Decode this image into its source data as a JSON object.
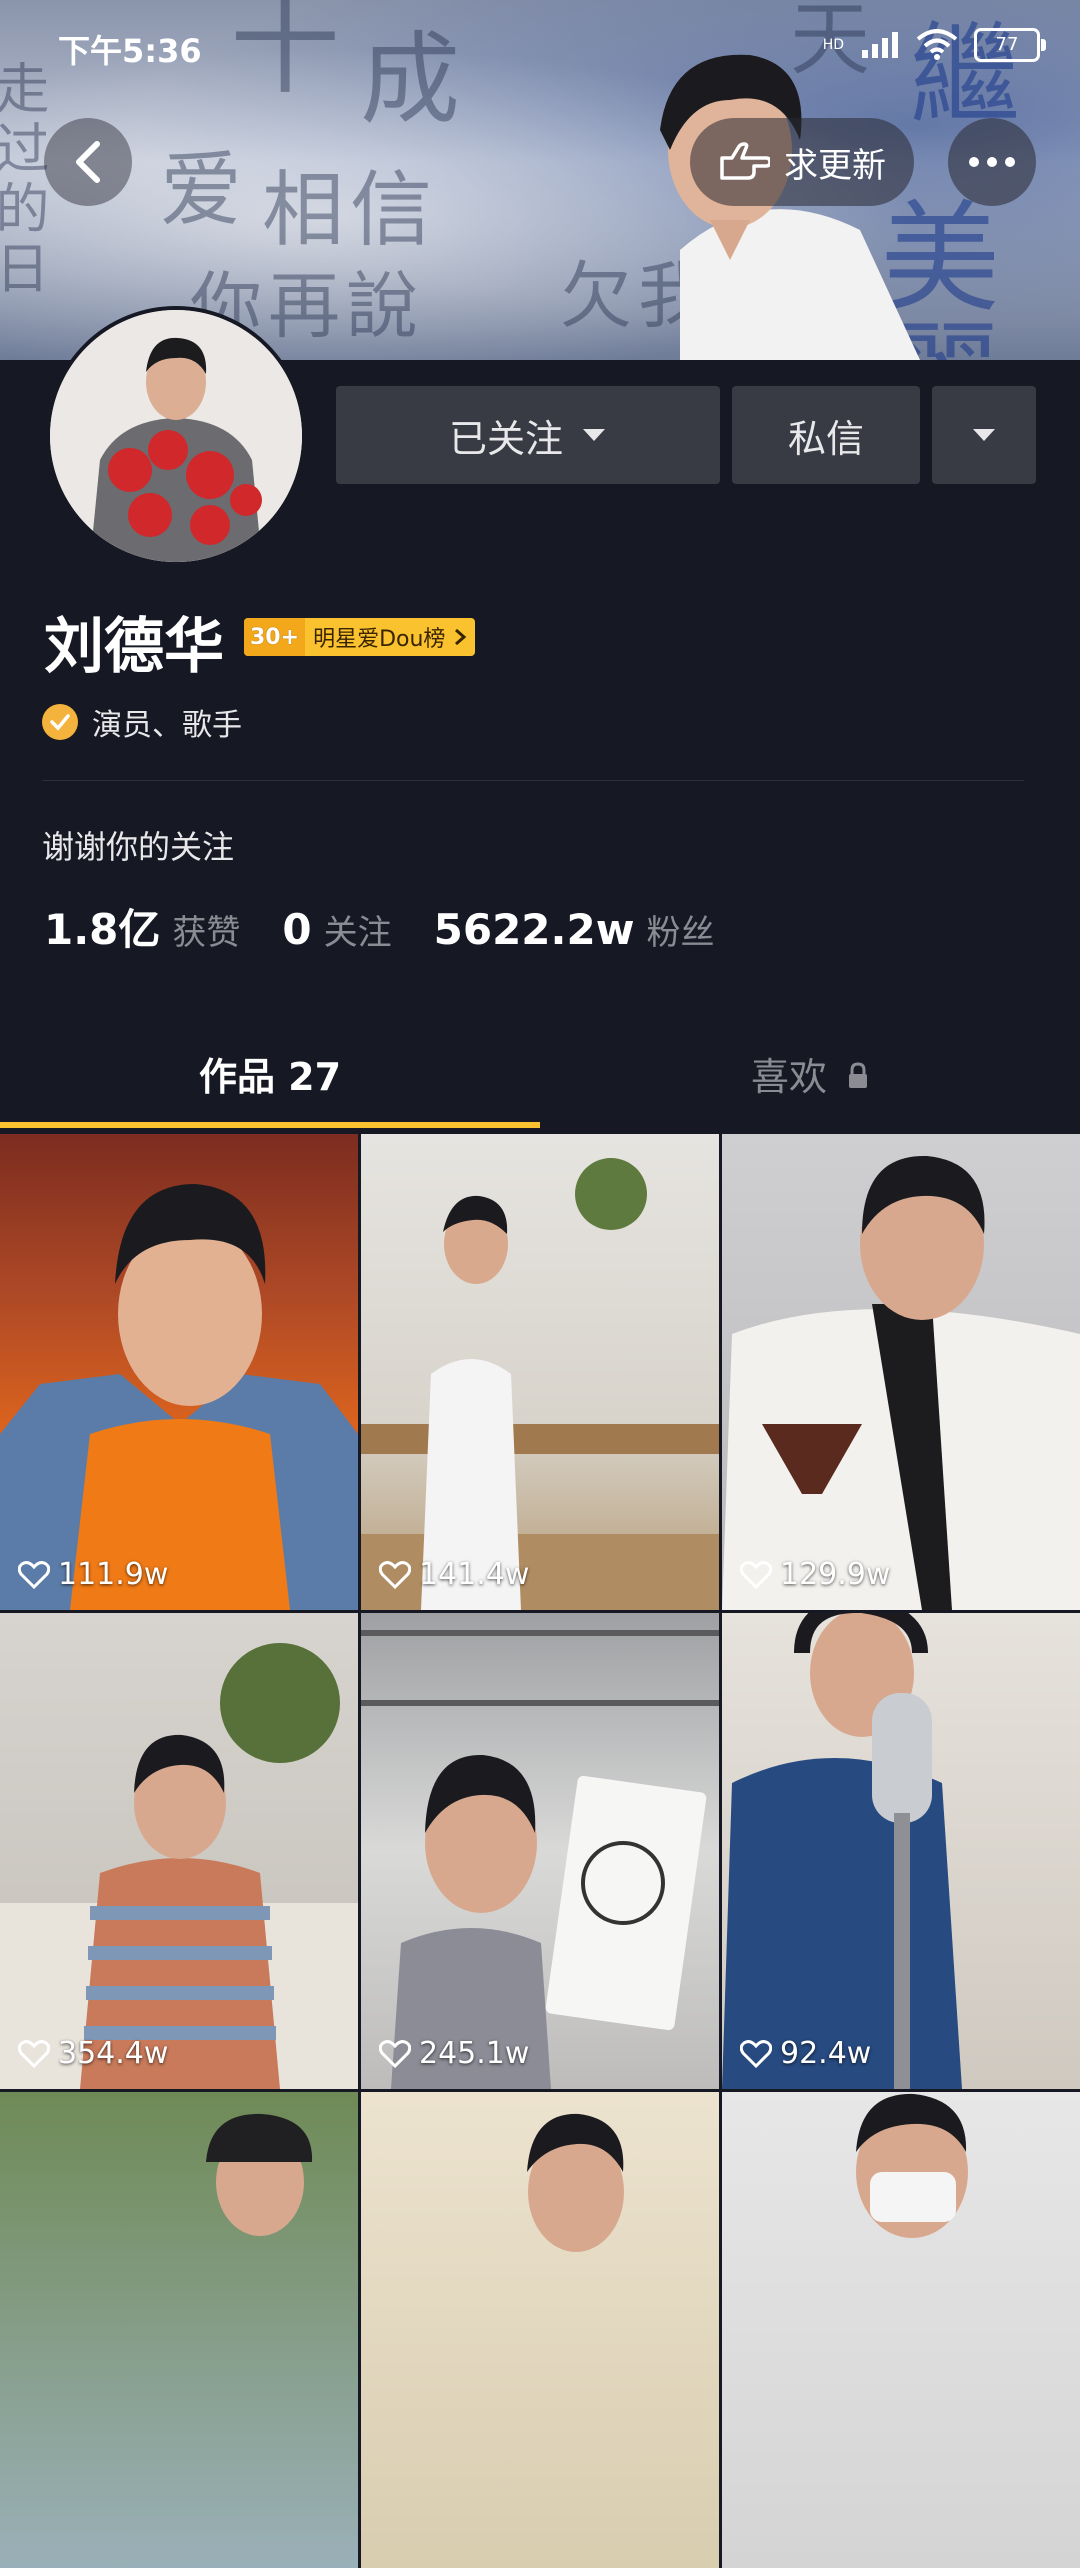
{
  "status_bar": {
    "time": "下午5:36",
    "signal_label": "HD",
    "battery": "77"
  },
  "header": {
    "update_label": "求更新"
  },
  "banner_text": [
    "走过的日",
    "爱",
    "相信",
    "你再說",
    "十",
    "成",
    "欠我",
    "天",
    "繼",
    "美麗"
  ],
  "profile": {
    "follow_label": "已关注",
    "message_label": "私信",
    "name": "刘德华",
    "rank_num": "30+",
    "rank_label": "明星爱Dou榜",
    "verified_label": "演员、歌手",
    "bio": "谢谢你的关注",
    "stats": {
      "likes_value": "1.8亿",
      "likes_label": "获赞",
      "following_value": "0",
      "following_label": "关注",
      "fans_value": "5622.2w",
      "fans_label": "粉丝"
    }
  },
  "tabs": {
    "works": "作品 27",
    "liked": "喜欢"
  },
  "videos": [
    {
      "likes": "111.9w"
    },
    {
      "likes": "141.4w"
    },
    {
      "likes": "129.9w"
    },
    {
      "likes": "354.4w"
    },
    {
      "likes": "245.1w"
    },
    {
      "likes": "92.4w"
    }
  ],
  "colors": {
    "background": "#161823",
    "accent": "#f9c22e",
    "button": "#393b44",
    "verified": "#f4b33c"
  },
  "icons": [
    "back-arrow-icon",
    "hand-pointer-icon",
    "more-dots-icon",
    "caret-down-icon",
    "verified-check-icon",
    "lock-icon",
    "heart-icon",
    "signal-icon",
    "wifi-icon",
    "battery-icon"
  ]
}
